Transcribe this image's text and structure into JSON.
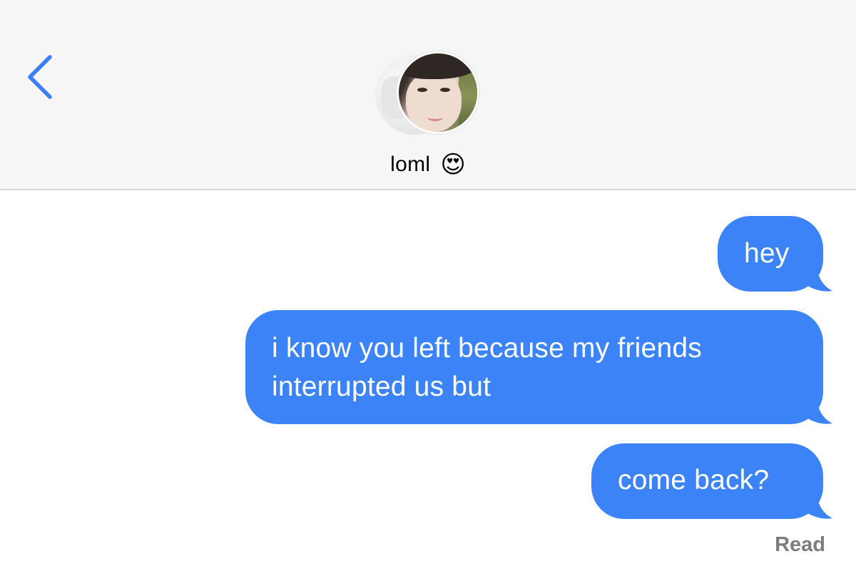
{
  "header": {
    "contact_name": "loml",
    "contact_emoji": "😍",
    "background_color": "#f6f6f6"
  },
  "icons": {
    "back": "chevron-left-icon",
    "avatar": "contact-avatar",
    "emoji": "heart-eyes-emoji"
  },
  "messages": [
    {
      "from": "me",
      "text": "hey"
    },
    {
      "from": "me",
      "text": "i know you left because my friends\ninterrupted us but"
    },
    {
      "from": "me",
      "text": "come back?"
    }
  ],
  "status": {
    "receipt": "Read"
  },
  "colors": {
    "accent": "#3b83f7",
    "back_chevron": "#3b7ef5",
    "bubble_text": "#ffffff",
    "receipt_text": "#7c7c7c"
  }
}
